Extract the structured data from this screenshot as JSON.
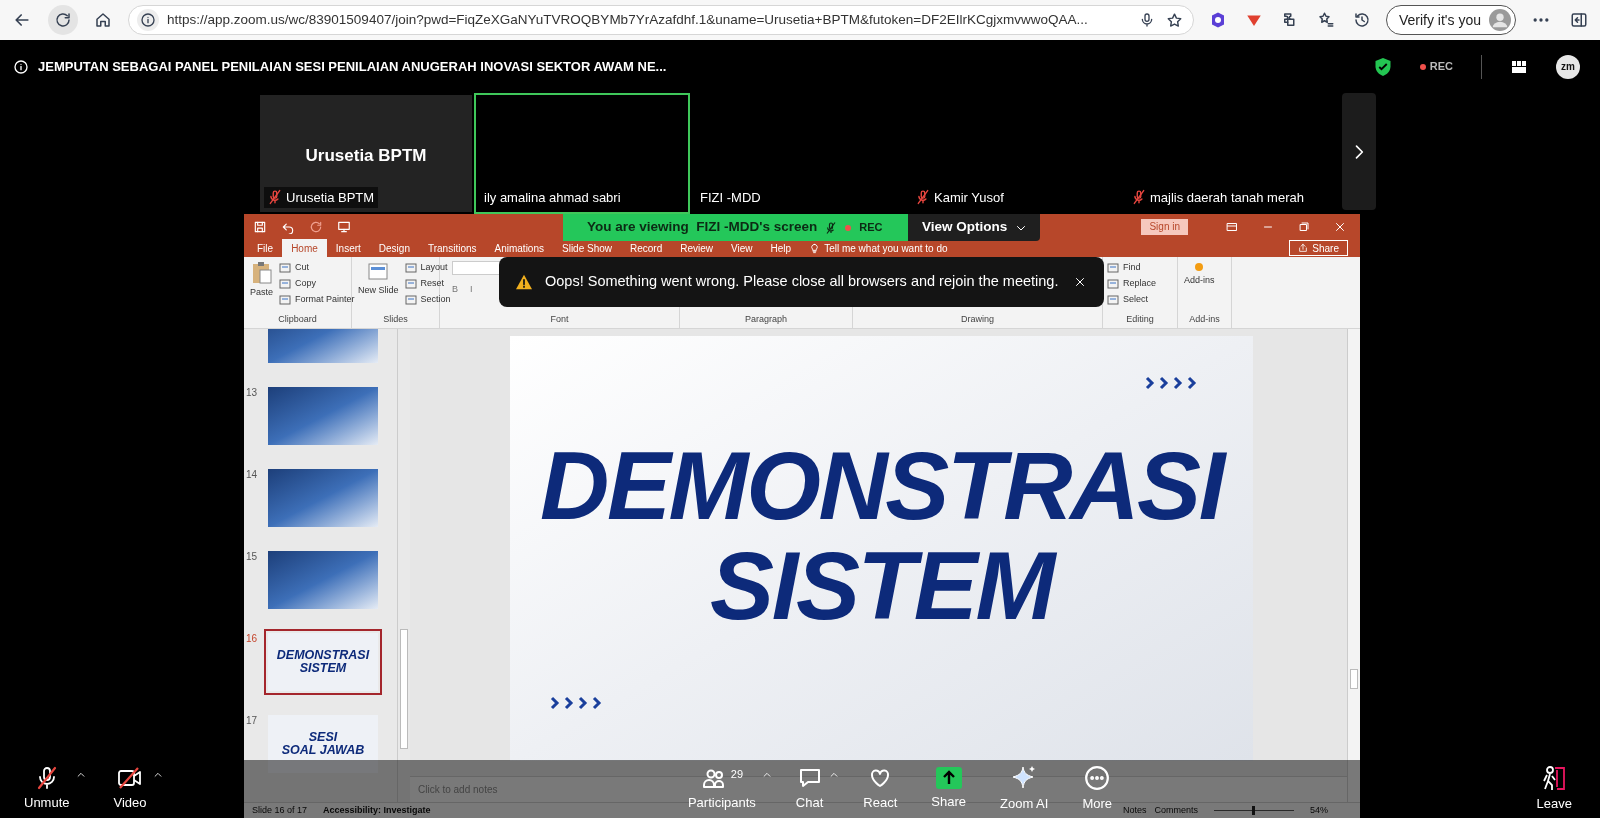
{
  "browser": {
    "url": "https://app.zoom.us/wc/83901509407/join?pwd=FiqZeXGaNYuTVROQBYMb7YrAzafdhf.1&uname=Urusetia+BPTM&futoken=DF2EIlrKCgjxmvwwoQAA...",
    "verify_button": "Verify it's you"
  },
  "meeting": {
    "title": "JEMPUTAN SEBAGAI PANEL PENILAIAN SESI PENILAIAN ANUGERAH INOVASI SEKTOR AWAM NE...",
    "recording": "REC",
    "app_badge": "zm"
  },
  "participants": [
    {
      "name": "Urusetia BPTM",
      "display_name": "Urusetia BPTM",
      "muted": true,
      "video_off": true,
      "speaking": false
    },
    {
      "name": "ily amalina ahmad sabri",
      "muted": false,
      "video_off": false,
      "speaking": true
    },
    {
      "name": "FIZI -MDD",
      "muted": false,
      "video_off": false,
      "speaking": false
    },
    {
      "name": "Kamir Yusof",
      "muted": true,
      "video_off": false,
      "speaking": false
    },
    {
      "name": "majlis daerah tanah merah",
      "muted": true,
      "video_off": false,
      "speaking": false
    }
  ],
  "share_banner": {
    "text": "You are viewing  FIZI -MDD's screen",
    "recording": "REC",
    "view_options": "View Options"
  },
  "error_toast": {
    "message": "Oops! Something went wrong. Please close all browsers and rejoin the meeting."
  },
  "powerpoint": {
    "sign_in": "Sign in",
    "share": "Share",
    "tell_me": "Tell me what you want to do",
    "tabs": [
      {
        "label": "File",
        "selected": false
      },
      {
        "label": "Home",
        "selected": true
      },
      {
        "label": "Insert",
        "selected": false
      },
      {
        "label": "Design",
        "selected": false
      },
      {
        "label": "Transitions",
        "selected": false
      },
      {
        "label": "Animations",
        "selected": false
      },
      {
        "label": "Slide Show",
        "selected": false
      },
      {
        "label": "Record",
        "selected": false
      },
      {
        "label": "Review",
        "selected": false
      },
      {
        "label": "View",
        "selected": false
      },
      {
        "label": "Help",
        "selected": false
      }
    ],
    "ribbon_groups": [
      {
        "name": "Clipboard",
        "commands": [
          {
            "kind": "large",
            "label": "Paste"
          },
          {
            "kind": "small",
            "label": "Cut"
          },
          {
            "kind": "small",
            "label": "Copy"
          },
          {
            "kind": "small",
            "label": "Format Painter"
          }
        ]
      },
      {
        "name": "Slides",
        "commands": [
          {
            "kind": "large",
            "label": "New Slide"
          },
          {
            "kind": "small",
            "label": "Layout"
          },
          {
            "kind": "small",
            "label": "Reset"
          },
          {
            "kind": "small",
            "label": "Section"
          }
        ]
      },
      {
        "name": "Font",
        "commands": [
          {
            "kind": "glyph",
            "label": "B"
          },
          {
            "kind": "glyph",
            "label": "I"
          }
        ]
      },
      {
        "name": "Paragraph"
      },
      {
        "name": "Drawing"
      },
      {
        "name": "Editing",
        "commands": [
          {
            "kind": "small",
            "label": "Find"
          },
          {
            "kind": "small",
            "label": "Replace"
          },
          {
            "kind": "small",
            "label": "Select"
          }
        ]
      },
      {
        "name": "Add-ins",
        "commands": [
          {
            "kind": "large",
            "label": "Add-ins"
          }
        ]
      }
    ],
    "thumbnails": [
      {
        "kind": "image",
        "selected": false
      },
      {
        "kind": "image",
        "number": "13",
        "selected": false
      },
      {
        "kind": "image",
        "number": "14",
        "selected": false
      },
      {
        "kind": "image",
        "number": "15",
        "selected": false
      },
      {
        "kind": "title",
        "number": "16",
        "selected": true,
        "lines": [
          "DEMONSTRASI",
          "SISTEM"
        ]
      },
      {
        "kind": "title",
        "number": "17",
        "selected": false,
        "lines": [
          "SESI",
          "SOAL JAWAB"
        ]
      }
    ],
    "slide": {
      "lines": [
        "DEMONSTRASI",
        "SISTEM"
      ]
    },
    "notes_placeholder": "Click to add notes",
    "status": {
      "slide_info": "Slide 16 of 17",
      "accessibility": "Accessibility: Investigate",
      "notes": "Notes",
      "comments": "Comments",
      "zoom_slider": {
        "level": 0.5
      },
      "zoom": "54%"
    }
  },
  "toolbar": [
    {
      "kind": "mic",
      "label": "Unmute",
      "off": true,
      "caret": true
    },
    {
      "kind": "video",
      "label": "Video",
      "off": true,
      "caret": true
    },
    {
      "kind": "participants",
      "label": "Participants",
      "count": "29",
      "caret": true
    },
    {
      "kind": "chat",
      "label": "Chat",
      "caret": true
    },
    {
      "kind": "react",
      "label": "React",
      "caret": false
    },
    {
      "kind": "share",
      "label": "Share",
      "caret": false
    },
    {
      "kind": "ai",
      "label": "Zoom AI",
      "caret": false
    },
    {
      "kind": "more",
      "label": "More",
      "caret": false
    },
    {
      "kind": "leave",
      "label": "Leave",
      "caret": false
    }
  ]
}
